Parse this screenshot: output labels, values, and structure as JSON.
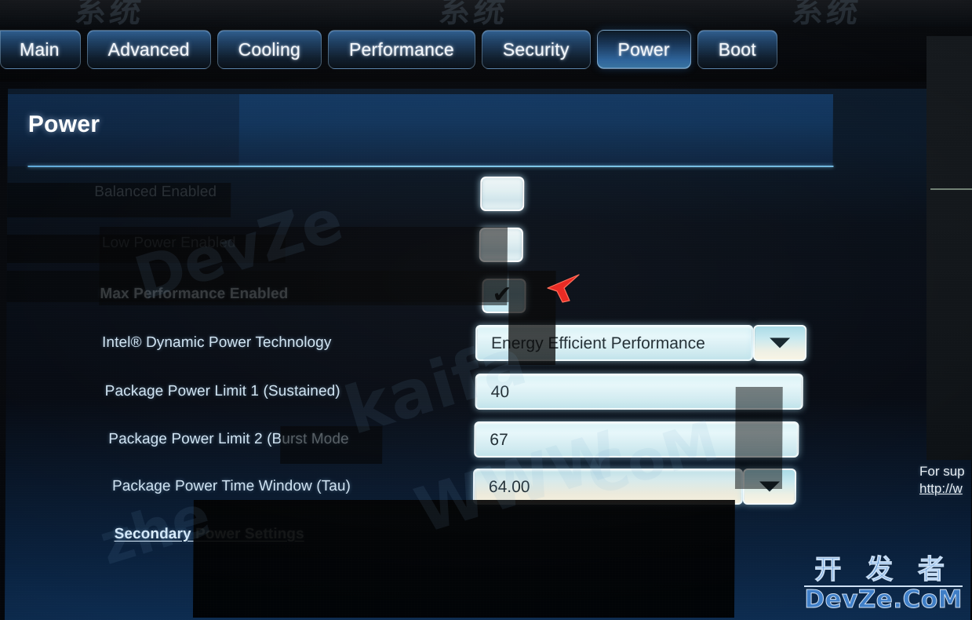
{
  "meta": {
    "screen_title": "Power",
    "watermark_cn": "开 发 者",
    "watermark_en": "DevZe.CoM",
    "top_watermark_cn": "系统",
    "accent_color": "#5ea8d8",
    "active_tab_color": "#2b6198",
    "field_color": "#dff3f7"
  },
  "tabs": [
    {
      "label": "Main",
      "active": false
    },
    {
      "label": "Advanced",
      "active": false
    },
    {
      "label": "Cooling",
      "active": false
    },
    {
      "label": "Performance",
      "active": false
    },
    {
      "label": "Security",
      "active": false
    },
    {
      "label": "Power",
      "active": true
    },
    {
      "label": "Boot",
      "active": false
    }
  ],
  "rows": [
    {
      "label": "Balanced Enabled",
      "control": "checkbox",
      "value": "",
      "state": "disabled"
    },
    {
      "label": "Low Power Enabled",
      "control": "checkbox",
      "value": "",
      "state": "disabled"
    },
    {
      "label": "Max Performance Enabled",
      "control": "checkbox",
      "value": "checked",
      "state": "enabled"
    },
    {
      "label": "Intel® Dynamic Power Technology",
      "control": "select",
      "value": "Energy Efficient Performance",
      "state": "enabled"
    },
    {
      "label": "Package Power Limit 1 (Sustained)",
      "control": "text",
      "value": "40",
      "state": "enabled"
    },
    {
      "label": "Package Power Limit 2 (Burst Mode",
      "control": "text",
      "value": "67",
      "state": "enabled"
    },
    {
      "label": "Package Power Time Window (Tau)",
      "control": "select",
      "value": "64.00",
      "state": "enabled"
    },
    {
      "label": "Secondary Power Settings",
      "control": "link",
      "value": "",
      "state": "enabled"
    }
  ],
  "checkbox_tick": "✔",
  "support": {
    "line1": "For sup",
    "line2": "http://w"
  }
}
